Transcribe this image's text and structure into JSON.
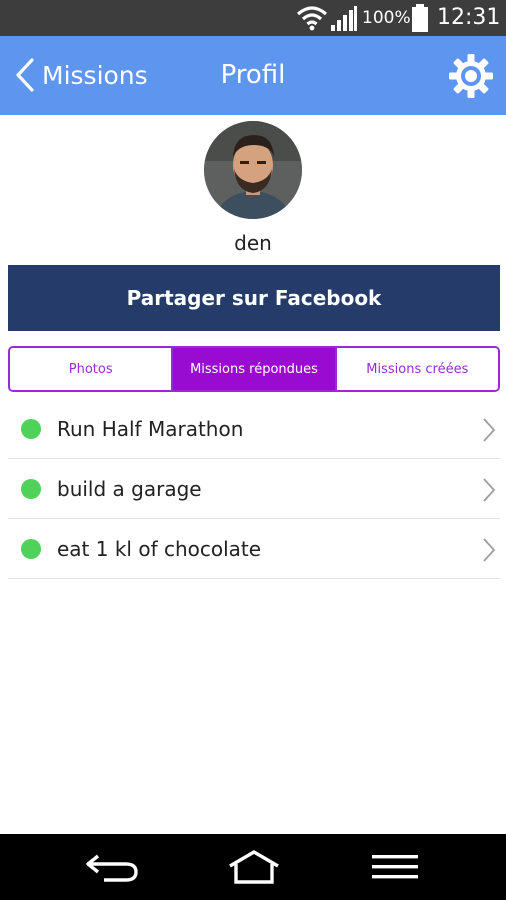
{
  "status_bar": {
    "battery_percent": "100%",
    "time": "12:31",
    "icons": [
      "wifi-icon",
      "signal-icon",
      "battery-icon"
    ]
  },
  "header": {
    "back_label": "Missions",
    "title": "Profil",
    "settings_icon": "gear-icon"
  },
  "profile": {
    "username": "den",
    "facebook_button": "Partager sur Facebook"
  },
  "tabs": [
    {
      "label": "Photos",
      "active": false
    },
    {
      "label": "Missions répondues",
      "active": true
    },
    {
      "label": "Missions créées",
      "active": false
    }
  ],
  "missions": [
    {
      "title": "Run Half Marathon",
      "status_color": "#4fd15a"
    },
    {
      "title": "build a garage",
      "status_color": "#4fd15a"
    },
    {
      "title": "eat 1 kl of chocolate",
      "status_color": "#4fd15a"
    }
  ],
  "nav_bar": {
    "icons": [
      "back-icon",
      "home-icon",
      "menu-icon"
    ]
  },
  "colors": {
    "header": "#5e95ef",
    "facebook": "#253b6a",
    "accent": "#9a0bd1",
    "status_dot": "#4fd15a"
  }
}
